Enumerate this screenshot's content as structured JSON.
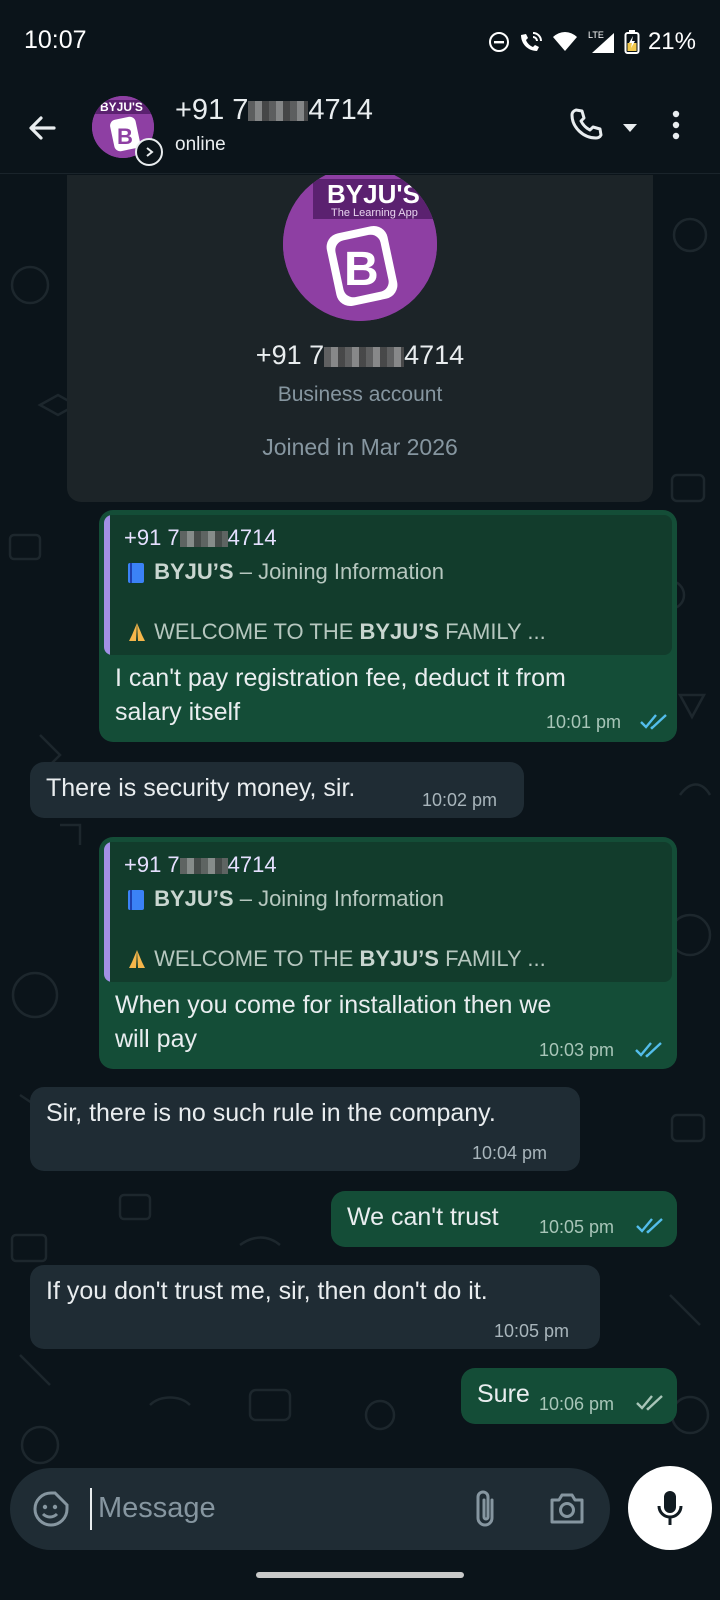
{
  "status_bar": {
    "time": "10:07",
    "battery": "21%",
    "network": "LTE"
  },
  "header": {
    "contact_prefix": "+91 7",
    "contact_suffix": "4714",
    "status": "online",
    "avatar_text": "BYJU'S",
    "avatar_letter": "B"
  },
  "profile_card": {
    "logo_text": "BYJU'S",
    "logo_tagline": "The Learning App",
    "logo_letter": "B",
    "number_prefix": "+91 7",
    "number_suffix": "4714",
    "account_type": "Business account",
    "joined": "Joined in Mar 2026"
  },
  "quoted": {
    "number_prefix": "+91 7",
    "number_suffix": "4714",
    "title_bold": "BYJU’S",
    "title_rest": " – Joining Information",
    "body_pre": "WELCOME TO THE ",
    "body_bold": "BYJU’S",
    "body_post": " FAMILY ..."
  },
  "messages": [
    {
      "dir": "out",
      "text_l1": "I can't pay registration fee, deduct it from",
      "text_l2": "salary itself",
      "time": "10:01 pm"
    },
    {
      "dir": "in",
      "text": "There is security money, sir.",
      "time": "10:02 pm"
    },
    {
      "dir": "out",
      "text_l1": "When you come for installation then we",
      "text_l2": "will pay",
      "time": "10:03 pm"
    },
    {
      "dir": "in",
      "text": "Sir, there is no such rule in the company.",
      "time": "10:04 pm"
    },
    {
      "dir": "out",
      "text": "We can't trust",
      "time": "10:05 pm"
    },
    {
      "dir": "in",
      "text": "If you don't trust me, sir, then don't do it.",
      "time": "10:05 pm"
    },
    {
      "dir": "out",
      "text": "Sure",
      "time": "10:06 pm"
    }
  ],
  "input": {
    "placeholder": "Message"
  },
  "icons": {
    "back": "arrow-left-icon",
    "call": "phone-icon",
    "more": "more-vert-icon",
    "emoji": "sticker-icon",
    "attach": "paperclip-icon",
    "camera": "camera-icon",
    "mic": "mic-icon"
  },
  "colors": {
    "outgoing_bubble": "#144d37",
    "incoming_bubble": "#1f2c34",
    "background": "#0b141a",
    "read_ticks": "#53bdeb",
    "brand_purple": "#8e3fa3"
  }
}
